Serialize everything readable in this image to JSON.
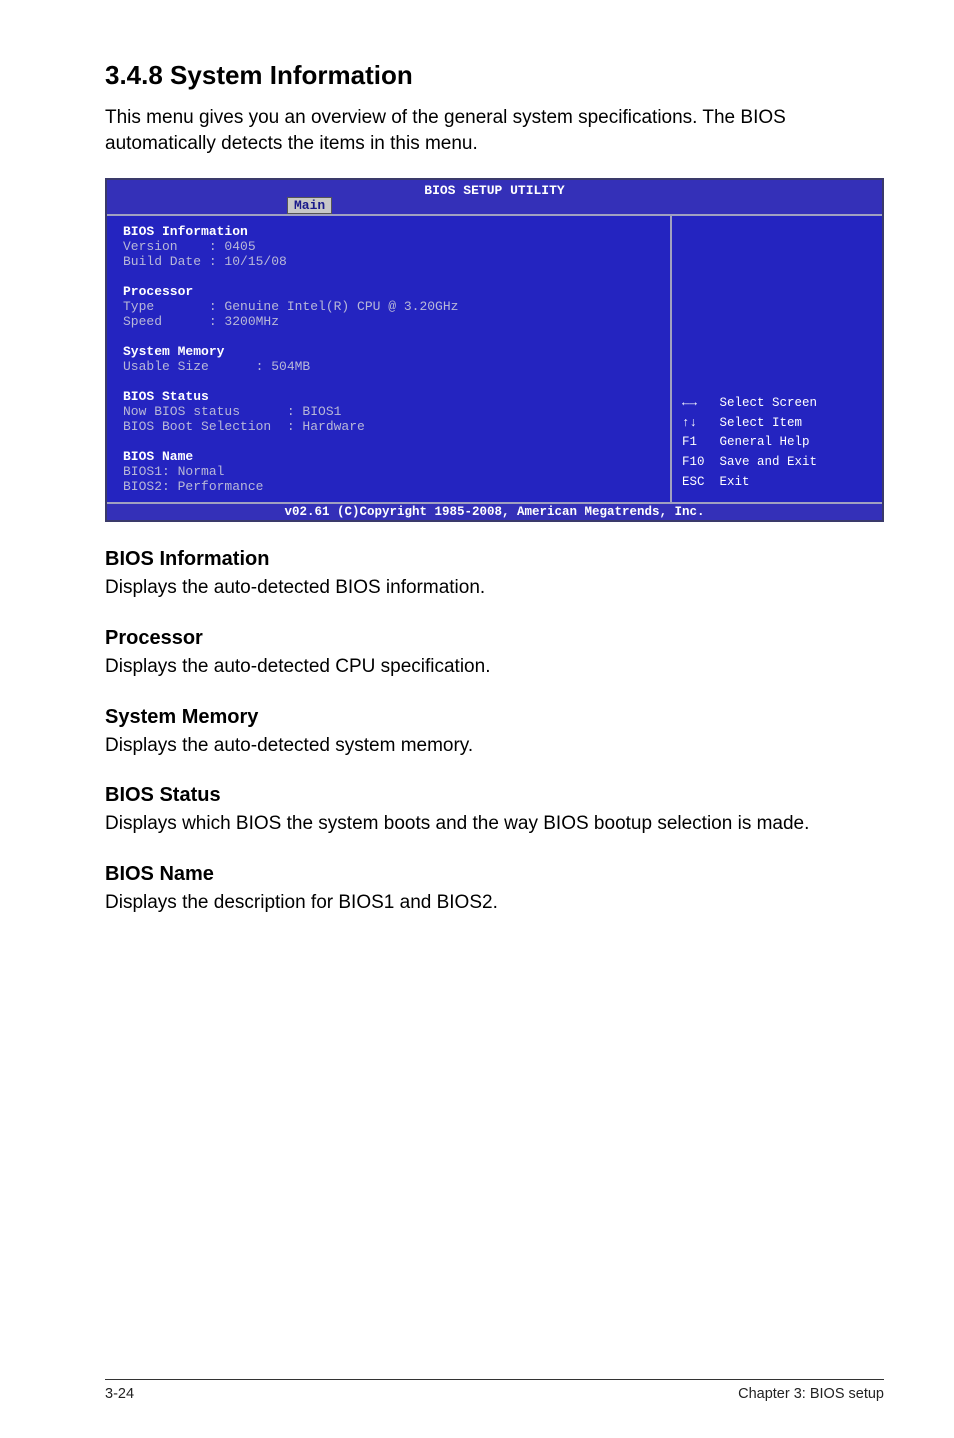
{
  "heading": "3.4.8      System Information",
  "intro": "This menu gives you an overview of the general system specifications. The BIOS automatically detects the items in this menu.",
  "bios": {
    "title": "BIOS SETUP UTILITY",
    "tab": "Main",
    "groups": {
      "bios_info": {
        "hdr": "BIOS Information",
        "version_line": "Version    : 0405",
        "build_line": "Build Date : 10/15/08"
      },
      "processor": {
        "hdr": "Processor",
        "type_line": "Type       : Genuine Intel(R) CPU @ 3.20GHz",
        "speed_line": "Speed      : 3200MHz"
      },
      "memory": {
        "hdr": "System Memory",
        "usable_line": "Usable Size      : 504MB"
      },
      "status": {
        "hdr": "BIOS Status",
        "now_line": "Now BIOS status      : BIOS1",
        "boot_line": "BIOS Boot Selection  : Hardware"
      },
      "name": {
        "hdr": "BIOS Name",
        "b1": "BIOS1: Normal",
        "b2": "BIOS2: Performance"
      }
    },
    "hints": {
      "h1": "←→   Select Screen",
      "h2": "↑↓   Select Item",
      "h3": "F1   General Help",
      "h4": "F10  Save and Exit",
      "h5": "ESC  Exit"
    },
    "footer": "v02.61 (C)Copyright 1985-2008, American Megatrends, Inc."
  },
  "body": {
    "s1h": "BIOS Information",
    "s1t": "Displays the auto-detected BIOS information.",
    "s2h": "Processor",
    "s2t": "Displays the auto-detected CPU specification.",
    "s3h": "System Memory",
    "s3t": "Displays the auto-detected system memory.",
    "s4h": "BIOS Status",
    "s4t": "Displays which BIOS the system boots and the way BIOS bootup selection is made.",
    "s5h": "BIOS Name",
    "s5t": "Displays the description for BIOS1 and BIOS2."
  },
  "footer": {
    "left": "3-24",
    "right": "Chapter 3: BIOS setup"
  }
}
